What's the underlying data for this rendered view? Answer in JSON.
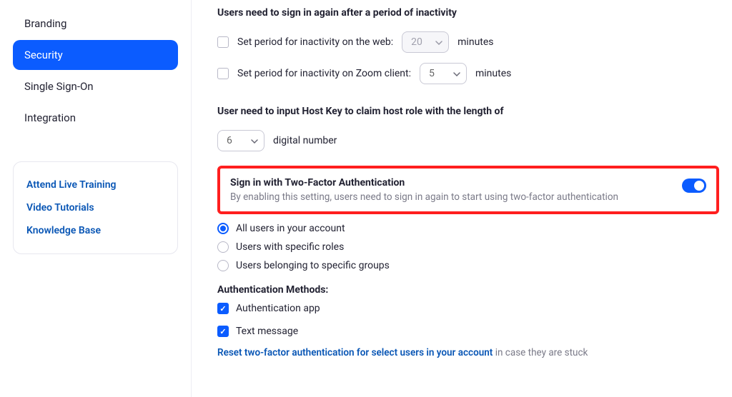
{
  "sidebar": {
    "nav": [
      {
        "label": "Branding",
        "active": false
      },
      {
        "label": "Security",
        "active": true
      },
      {
        "label": "Single Sign-On",
        "active": false
      },
      {
        "label": "Integration",
        "active": false
      }
    ],
    "help_links": [
      "Attend Live Training",
      "Video Tutorials",
      "Knowledge Base"
    ]
  },
  "main": {
    "inactivity": {
      "heading": "Users need to sign in again after a period of inactivity",
      "web": {
        "label": "Set period for inactivity on the web:",
        "value": "20",
        "unit": "minutes",
        "checked": false,
        "disabled": true
      },
      "zoom": {
        "label": "Set period for inactivity on Zoom client:",
        "value": "5",
        "unit": "minutes",
        "checked": false,
        "disabled": false
      }
    },
    "host_key": {
      "heading": "User need to input Host Key to claim host role with the length of",
      "value": "6",
      "unit": "digital number"
    },
    "twofa": {
      "title": "Sign in with Two-Factor Authentication",
      "description": "By enabling this setting, users need to sign in again to start using two-factor authentication",
      "enabled": true,
      "options": [
        {
          "label": "All users in your account",
          "selected": true
        },
        {
          "label": "Users with specific roles",
          "selected": false
        },
        {
          "label": "Users belonging to specific groups",
          "selected": false
        }
      ],
      "methods_title": "Authentication Methods:",
      "methods": [
        {
          "label": "Authentication app",
          "checked": true
        },
        {
          "label": "Text message",
          "checked": true
        }
      ],
      "reset_link": "Reset two-factor authentication for select users in your account",
      "reset_suffix": "in case they are stuck"
    }
  }
}
